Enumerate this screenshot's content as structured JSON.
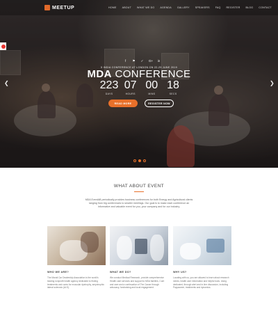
{
  "brand": {
    "logo_text": "MEETUP",
    "accent": "#e8702a"
  },
  "nav": {
    "items": [
      "HOME",
      "ABOUT",
      "WHAT WE DO",
      "AGENDA",
      "GALLERY",
      "SPEAKERS",
      "FAQ",
      "REGISTER",
      "BLOG",
      "CONTACT"
    ]
  },
  "social": [
    "f",
    "⚑",
    "✓",
    "G+",
    "in"
  ],
  "hero": {
    "kicker": "5 INDIA CONFERENCE AT LONDON ON 22-25 JUNE 2019",
    "title_strong": "MDA",
    "title_rest": " CONFERENCE",
    "countdown": [
      {
        "value": "223",
        "label": "DAYS"
      },
      {
        "value": "07",
        "label": "HOURS"
      },
      {
        "value": "00",
        "label": "MINS"
      },
      {
        "value": "18",
        "label": "SECS"
      }
    ],
    "primary_button": "READ MORE",
    "secondary_button": "REGISTER NOW"
  },
  "about": {
    "title": "WHAT ABOUT EVENT",
    "text": "MDA EventAB periodically provides business conferences for both Energy and Agricultural clients ranging from big conferences to smaller meetings. Our goal is to make each conference an informative and valuable event for you, your company and for our industry."
  },
  "cards": [
    {
      "caption": "WHO WE ARE?",
      "text": "The Maruti Car Dealership Association is the world's leading nonprofit health agency dedicated to finding treatments and cures for muscular dystrophy, amyotrophic lateral sclerosis (ALS)."
    },
    {
      "caption": "WHAT WE DO?",
      "text": "We conduct Medical Research, provide comprehensive Health care services and support to MDA families, Cure and care and a continuation of The Cause through advocacy, fundraising and local engagement."
    },
    {
      "caption": "WHY US?",
      "text": "Locating with us, you are allowed to learn about research needs, health care information and helpful tools. Using dedicated, through alert and in-line discussion, including Pappaceee, treatments and dynamics."
    }
  ]
}
